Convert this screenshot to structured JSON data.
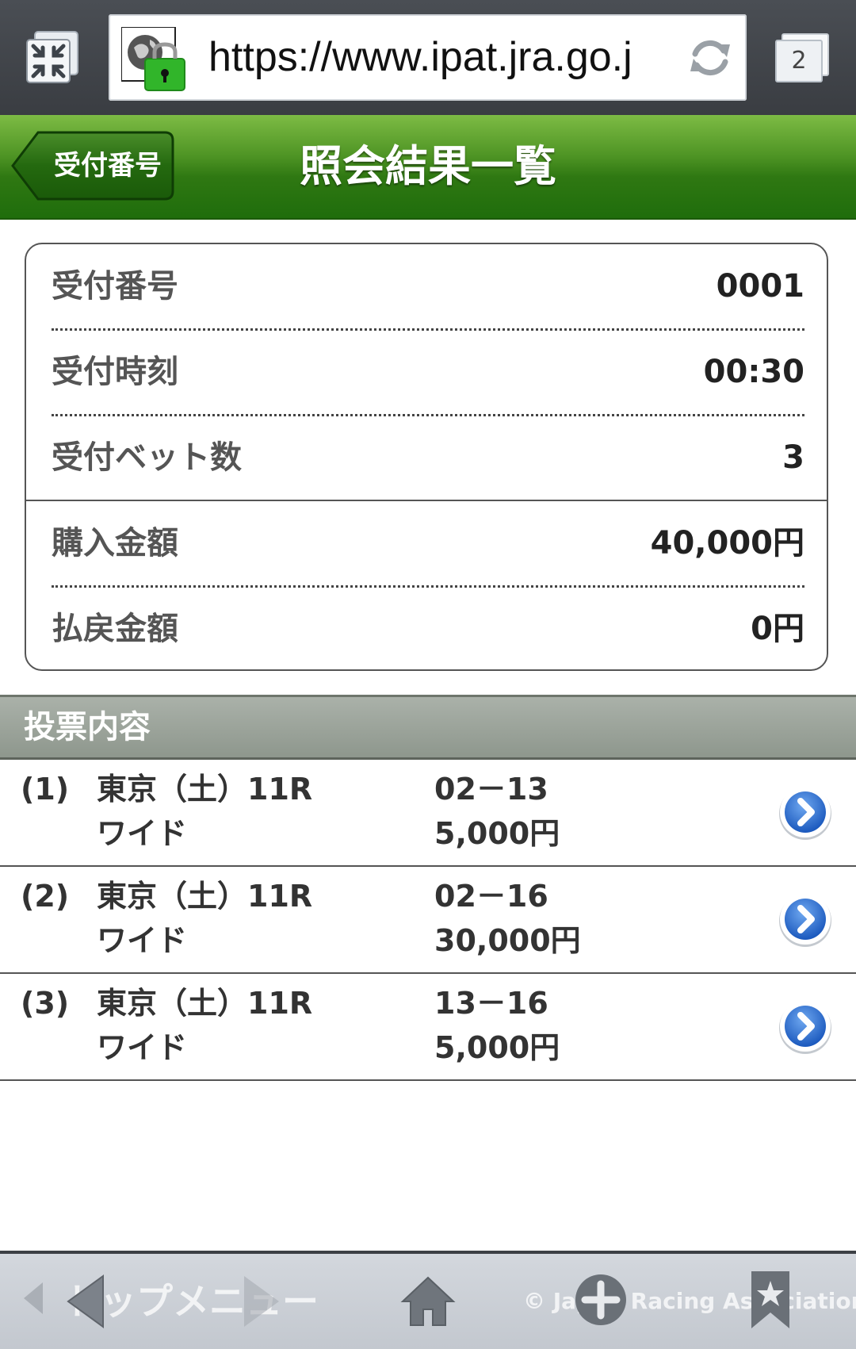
{
  "browser": {
    "url": "https://www.ipat.jra.go.j",
    "tab_count": "2"
  },
  "header": {
    "back_label": "受付番号",
    "title": "照会結果一覧"
  },
  "summary": {
    "receipt_number": {
      "label": "受付番号",
      "value": "0001"
    },
    "receipt_time": {
      "label": "受付時刻",
      "value": "00:30"
    },
    "bet_count": {
      "label": "受付ベット数",
      "value": "3"
    },
    "purchase_amount": {
      "label": "購入金額",
      "value": "40,000円"
    },
    "refund_amount": {
      "label": "払戻金額",
      "value": "0円"
    }
  },
  "bets_section": {
    "title": "投票内容",
    "items": [
      {
        "num": "(1)",
        "race": "東京（土）11R",
        "type": "ワイド",
        "combo": "02－13",
        "amount": "5,000円"
      },
      {
        "num": "(2)",
        "race": "東京（土）11R",
        "type": "ワイド",
        "combo": "02－16",
        "amount": "30,000円"
      },
      {
        "num": "(3)",
        "race": "東京（土）11R",
        "type": "ワイド",
        "combo": "13－16",
        "amount": "5,000円"
      }
    ]
  },
  "bottom_bar": {
    "top_menu_label": "トップメニュー",
    "copyright": "© Japan Racing Association."
  },
  "colors": {
    "header_green": "#2f7812",
    "section_gray": "#8e978d",
    "detail_blue": "#1e63c8"
  },
  "icons": {
    "fullscreen": "fullscreen-exit-icon",
    "security": "lock-icon",
    "reload": "reload-icon",
    "back": "chevron-left-icon",
    "detail": "chevron-right-icon",
    "home": "home-icon",
    "add": "plus-icon",
    "bookmark": "bookmark-icon"
  }
}
